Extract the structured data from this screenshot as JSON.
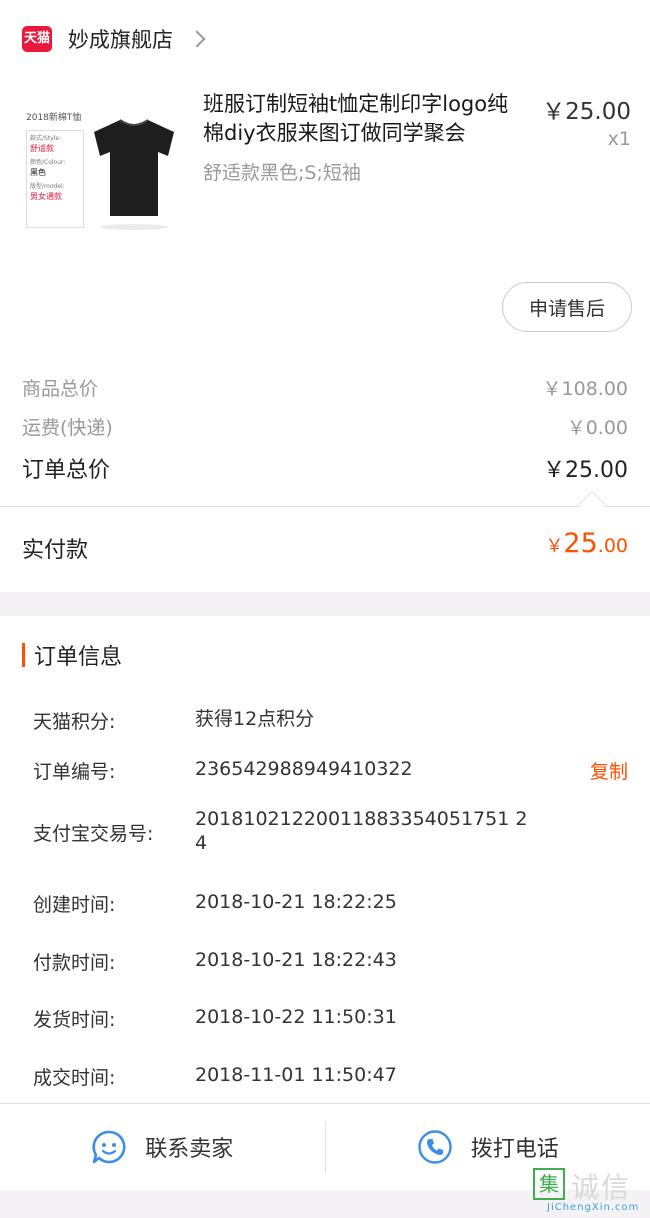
{
  "shop": {
    "logo_text": "天猫",
    "name": "妙成旗舰店"
  },
  "product": {
    "thumb_title": "2018新棉T恤",
    "thumb_details": [
      {
        "key": "款式/Style:",
        "value": "舒适款",
        "color": "red"
      },
      {
        "key": "颜色/Colour:",
        "value": "黑色",
        "color": "dark"
      },
      {
        "key": "版型/model:",
        "value": "男女通款",
        "color": "red"
      }
    ],
    "title": "班服订制短袖t恤定制印字logo纯棉diy衣服来图订做同学聚会",
    "spec": "舒适款黑色;S;短袖",
    "price": "￥25.00",
    "qty": "x1",
    "aftersale_label": "申请售后"
  },
  "summary": {
    "goods_total": {
      "label": "商品总价",
      "value": "￥108.00"
    },
    "shipping": {
      "label": "运费(快递)",
      "value": "￥0.00"
    },
    "order_total": {
      "label": "订单总价",
      "value": "￥25.00"
    },
    "paid": {
      "label": "实付款",
      "currency": "￥",
      "integer": "25",
      "decimal": ".00"
    }
  },
  "order_info": {
    "title": "订单信息",
    "rows": [
      {
        "key": "天猫积分:",
        "value": "获得12点积分"
      },
      {
        "key": "订单编号:",
        "value": "236542988949410322",
        "action": "复制"
      },
      {
        "key": "支付宝交易号:",
        "value": "20181021220011883354051751 24"
      },
      {
        "key": "创建时间:",
        "value": "2018-10-21 18:22:25"
      },
      {
        "key": "付款时间:",
        "value": "2018-10-21 18:22:43"
      },
      {
        "key": "发货时间:",
        "value": "2018-10-22 11:50:31"
      },
      {
        "key": "成交时间:",
        "value": "2018-11-01 11:50:47"
      }
    ]
  },
  "footer": {
    "contact_label": "联系卖家",
    "call_label": "拨打电话"
  },
  "watermark": {
    "box_char": "集",
    "text": "诚信",
    "url": "JiChengXin.com"
  },
  "colors": {
    "accent": "#ff5000",
    "tmall_red": "#e8193c",
    "icon_blue": "#3a8ee6"
  }
}
